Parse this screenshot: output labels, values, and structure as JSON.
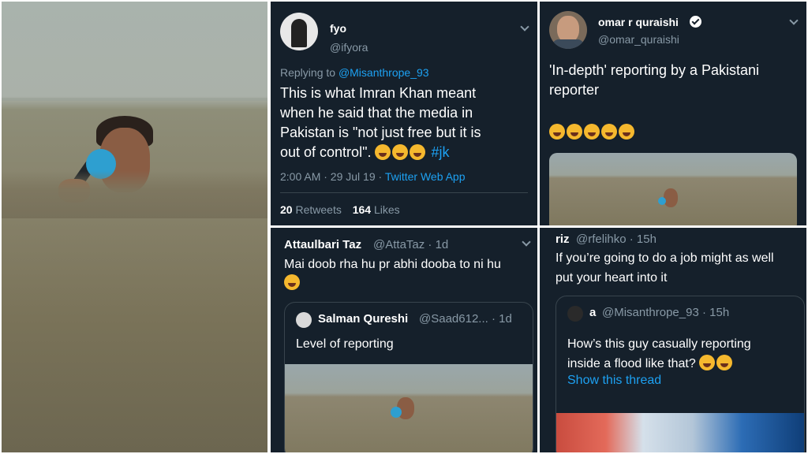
{
  "colors": {
    "bg": "#15202b",
    "link": "#1da1f2",
    "muted": "#8899a6",
    "border": "#38444d"
  },
  "tweet_fyo": {
    "name": "fyo",
    "handle": "@ifyora",
    "replying_prefix": "Replying to",
    "replying_to": "@Misanthrope_93",
    "lines": [
      "This is what Imran Khan meant",
      "when he said that the media in",
      "Pakistan is \"not just free but it is",
      "out of control\"."
    ],
    "hashtag": "#jk",
    "meta": "2:00 AM · 29 Jul 19 ·",
    "app": "Twitter Web App",
    "retweets_count": "20",
    "retweets_label": "Retweets",
    "likes_count": "164",
    "likes_label": "Likes"
  },
  "tweet_omar": {
    "name": "omar r quraishi",
    "handle": "@omar_quraishi",
    "lines": [
      "'In-depth' reporting by a Pakistani",
      "reporter"
    ]
  },
  "tweet_attaulbari": {
    "name": "Attaulbari Taz",
    "handle": "@AttaTaz · 1d",
    "text": "Mai doob rha hu pr abhi dooba to ni hu",
    "quote": {
      "name": "Salman Qureshi",
      "handle": "@Saad612... · 1d",
      "text": "Level of reporting"
    }
  },
  "tweet_riz": {
    "name": "riz",
    "handle": "@rfelihko · 15h",
    "lines": [
      "If you’re going to do a job might as well",
      "put your heart into it"
    ],
    "quote": {
      "name": "a",
      "handle": "@Misanthrope_93 · 15h",
      "lines": [
        "How’s this guy casually reporting",
        "inside a flood like that?"
      ],
      "show_thread": "Show this thread"
    }
  },
  "icons": [
    "chevron-down-icon",
    "verified-badge-icon",
    "laughing-emoji-icon",
    "avatar"
  ]
}
